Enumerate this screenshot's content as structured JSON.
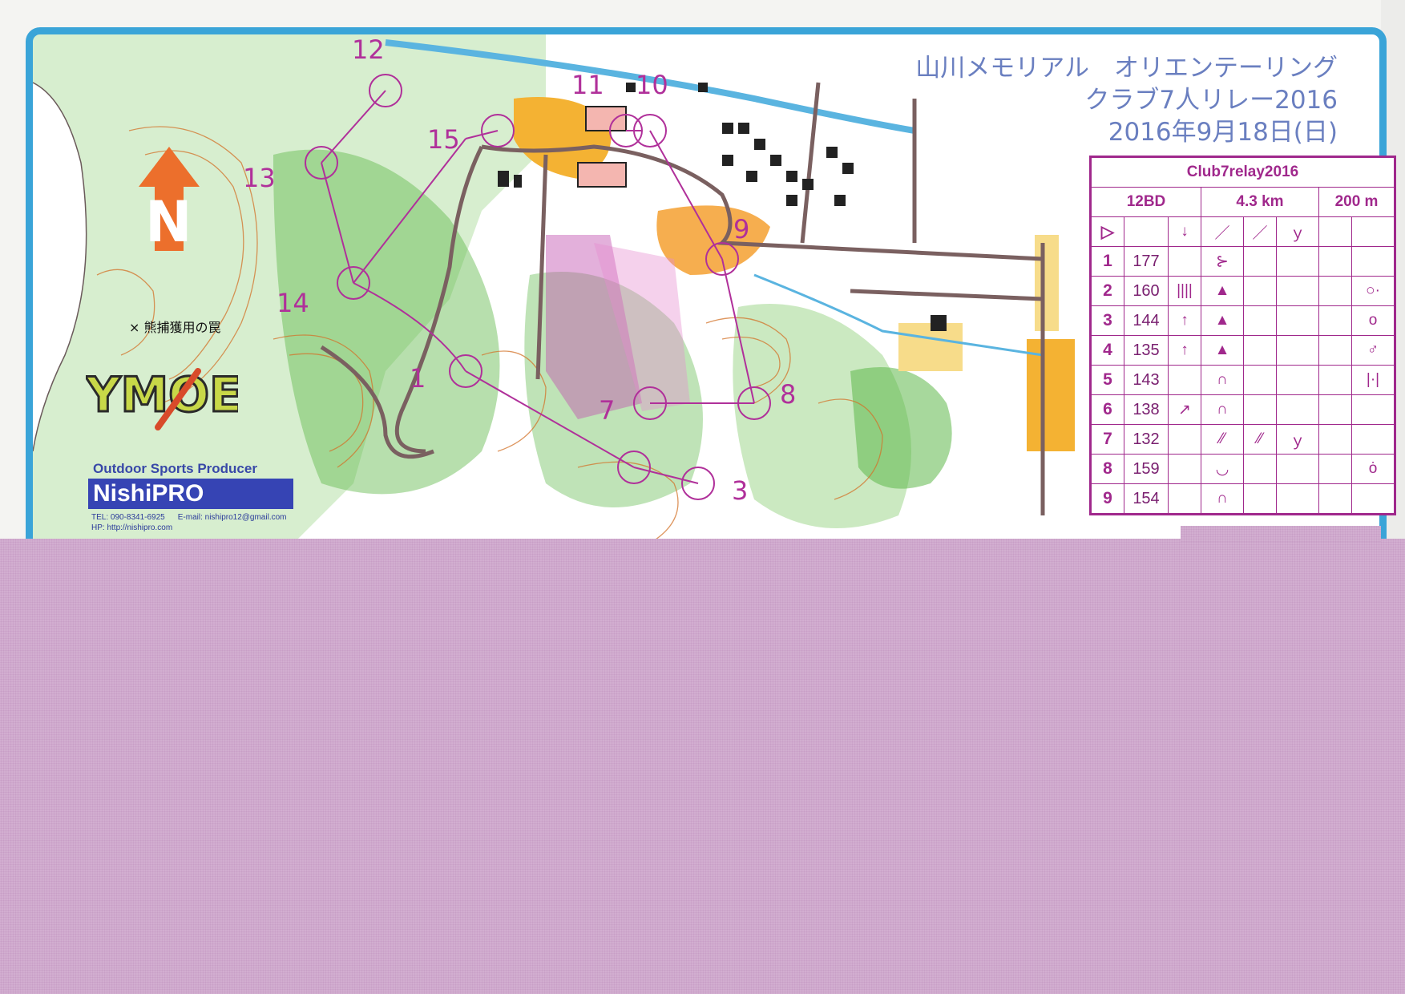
{
  "header": {
    "title_line1": "山川メモリアル　オリエンテーリング",
    "title_line2": "クラブ7人リレー2016",
    "date": "2016年9月18日(日)"
  },
  "map": {
    "north_arrow_letter": "N",
    "legend_trap": "×  熊捕獲用の罠",
    "control_labels": [
      "1",
      "3",
      "7",
      "8",
      "9",
      "10",
      "11",
      "12",
      "13",
      "14",
      "15"
    ],
    "colors": {
      "frame": "#3aa4d8",
      "course": "#b0309a",
      "forest": "#5fb84a",
      "contour": "#d3732a",
      "open": "#f4b233",
      "building": "#222222",
      "road": "#7a6060",
      "water": "#5ab4e0"
    }
  },
  "sponsor": {
    "ymoe_logo": "YMOE",
    "tagline": "Outdoor Sports Producer",
    "brand": "NishiPRO",
    "tel": "TEL: 090-8341-6925",
    "email": "E-mail: nishipro12@gmail.com",
    "hp": "HP: http://nishipro.com"
  },
  "control_descriptions": {
    "event": "Club7relay2016",
    "course": "12BD",
    "length": "4.3 km",
    "climb": "200 m",
    "start_symbol": "▷",
    "start_row": [
      "↓",
      "／",
      "／",
      "ｙ"
    ],
    "rows": [
      {
        "num": "1",
        "code": "177",
        "dir": "",
        "feature": "⊱",
        "c4": "",
        "c5": "",
        "detail": ""
      },
      {
        "num": "2",
        "code": "160",
        "dir": "||||",
        "feature": "▲",
        "c4": "",
        "c5": "",
        "detail": "○·"
      },
      {
        "num": "3",
        "code": "144",
        "dir": "↑",
        "feature": "▲",
        "c4": "",
        "c5": "",
        "detail": "o"
      },
      {
        "num": "4",
        "code": "135",
        "dir": "↑",
        "feature": "▲",
        "c4": "",
        "c5": "",
        "detail": "♂"
      },
      {
        "num": "5",
        "code": "143",
        "dir": "",
        "feature": "∩",
        "c4": "",
        "c5": "",
        "detail": "|·|"
      },
      {
        "num": "6",
        "code": "138",
        "dir": "↗",
        "feature": "∩",
        "c4": "",
        "c5": "",
        "detail": ""
      },
      {
        "num": "7",
        "code": "132",
        "dir": "",
        "feature": "⁄⁄",
        "c4": "⁄⁄",
        "c5": "ｙ",
        "detail": ""
      },
      {
        "num": "8",
        "code": "159",
        "dir": "",
        "feature": "◡",
        "c4": "",
        "c5": "",
        "detail": "ȯ"
      },
      {
        "num": "9",
        "code": "154",
        "dir": "",
        "feature": "∩",
        "c4": "",
        "c5": "",
        "detail": ""
      }
    ]
  }
}
